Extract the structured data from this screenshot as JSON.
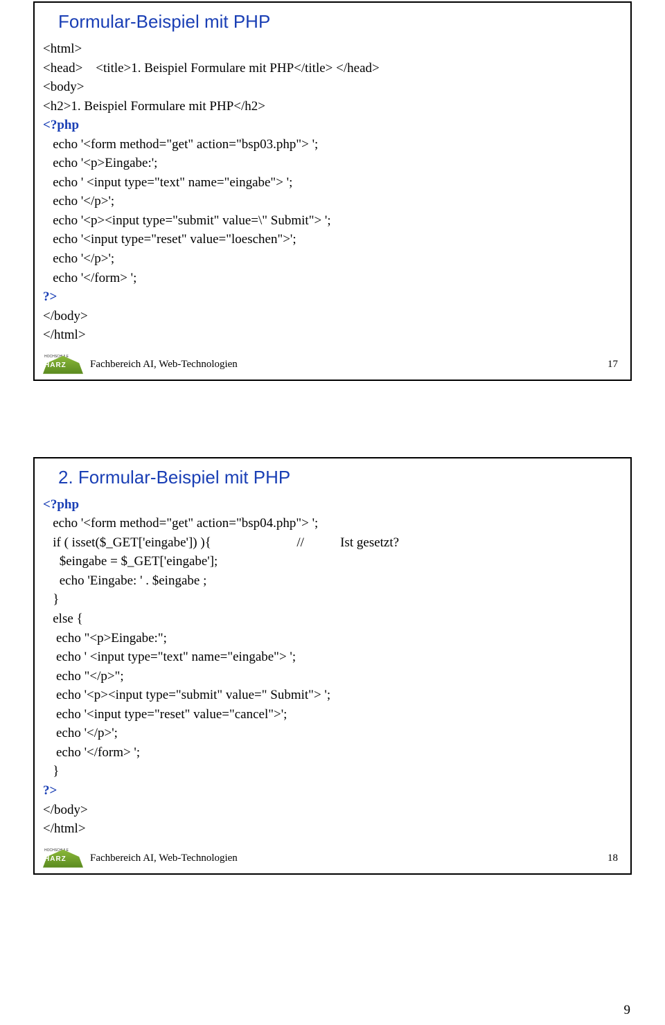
{
  "slide1": {
    "title": "Formular-Beispiel mit PHP",
    "code_lines": [
      "<html>",
      "<head>    <title>1. Beispiel Formulare mit PHP</title> </head>",
      "<body>",
      "<h2>1. Beispiel Formulare mit PHP</h2>"
    ],
    "php_open": "<?php",
    "php_body": [
      "   echo '<form method=\"get\" action=\"bsp03.php\"> ';",
      "   echo '<p>Eingabe:';",
      "   echo ' <input type=\"text\" name=\"eingabe\"> ';",
      "   echo '</p>';",
      "   echo '<p><input type=\"submit\" value=\\\" Submit\"> ';",
      "   echo '<input type=\"reset\" value=\"loeschen\">';",
      "   echo '</p>';",
      "   echo '</form> ';"
    ],
    "php_close": "?>",
    "code_after": [
      "</body>",
      "</html>"
    ],
    "footer_text": "Fachbereich AI, Web-Technologien",
    "footer_page": "17"
  },
  "slide2": {
    "title": "2. Formular-Beispiel mit PHP",
    "php_open": "<?php",
    "line_form": "   echo '<form method=\"get\" action=\"bsp04.php\"> ';",
    "line_isset_code": "   if ( isset($_GET['eingabe']) ){",
    "line_isset_comment": "//           Ist gesetzt?",
    "php_body": [
      "     $eingabe = $_GET['eingabe'];",
      "     echo 'Eingabe: ' . $eingabe ;",
      "   }",
      "   else {",
      "    echo \"<p>Eingabe:\";",
      "    echo ' <input type=\"text\" name=\"eingabe\"> ';",
      "    echo \"</p>\";",
      "    echo '<p><input type=\"submit\" value=\" Submit\"> ';",
      "    echo '<input type=\"reset\" value=\"cancel\">';",
      "    echo '</p>';",
      "    echo '</form> ';",
      "   }"
    ],
    "php_close": "?>",
    "code_after": [
      "</body>",
      "</html>"
    ],
    "footer_text": "Fachbereich AI, Web-Technologien",
    "footer_page": "18"
  },
  "page_number": "9",
  "logo_label": "HARZ",
  "logo_top": "HOCHSCHULE"
}
